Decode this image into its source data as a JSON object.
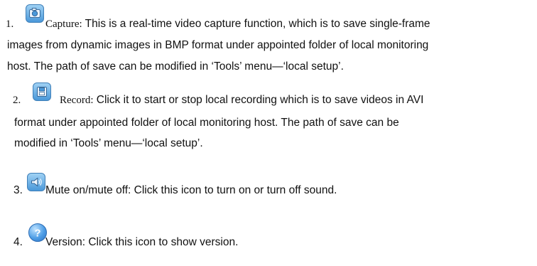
{
  "items": [
    {
      "number": "1.",
      "title": "Capture:",
      "icon": "camera-icon",
      "lines": [
        " This is a real-time video capture function, which is to save single-frame",
        "images from dynamic images in BMP format under appointed folder of local monitoring",
        "host. The path of save can be modified in ‘Tools’ menu—‘local setup’."
      ]
    },
    {
      "number": "2.",
      "title": "Record:",
      "icon": "record-icon",
      "lines": [
        " Click it to start or stop local recording which is to save videos in AVI",
        "format under appointed folder of local monitoring host. The path of save can be",
        "modified in ‘Tools’ menu—‘local setup’."
      ]
    },
    {
      "number": "3.",
      "title": "Mute on/mute off:",
      "icon": "speaker-icon",
      "lines": [
        " Click this icon to turn on or turn off sound."
      ]
    },
    {
      "number": "4.",
      "title": "Version:",
      "icon": "help-icon",
      "lines": [
        " Click this icon to show version."
      ]
    }
  ]
}
